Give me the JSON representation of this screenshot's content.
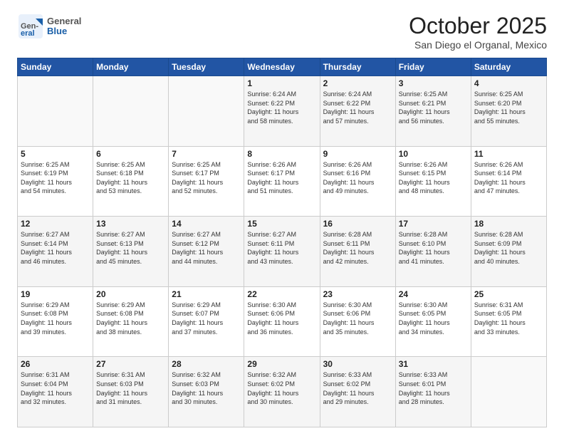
{
  "logo": {
    "general": "General",
    "blue": "Blue"
  },
  "header": {
    "month": "October 2025",
    "location": "San Diego el Organal, Mexico"
  },
  "days_of_week": [
    "Sunday",
    "Monday",
    "Tuesday",
    "Wednesday",
    "Thursday",
    "Friday",
    "Saturday"
  ],
  "weeks": [
    [
      {
        "num": "",
        "info": ""
      },
      {
        "num": "",
        "info": ""
      },
      {
        "num": "",
        "info": ""
      },
      {
        "num": "1",
        "info": "Sunrise: 6:24 AM\nSunset: 6:22 PM\nDaylight: 11 hours\nand 58 minutes."
      },
      {
        "num": "2",
        "info": "Sunrise: 6:24 AM\nSunset: 6:22 PM\nDaylight: 11 hours\nand 57 minutes."
      },
      {
        "num": "3",
        "info": "Sunrise: 6:25 AM\nSunset: 6:21 PM\nDaylight: 11 hours\nand 56 minutes."
      },
      {
        "num": "4",
        "info": "Sunrise: 6:25 AM\nSunset: 6:20 PM\nDaylight: 11 hours\nand 55 minutes."
      }
    ],
    [
      {
        "num": "5",
        "info": "Sunrise: 6:25 AM\nSunset: 6:19 PM\nDaylight: 11 hours\nand 54 minutes."
      },
      {
        "num": "6",
        "info": "Sunrise: 6:25 AM\nSunset: 6:18 PM\nDaylight: 11 hours\nand 53 minutes."
      },
      {
        "num": "7",
        "info": "Sunrise: 6:25 AM\nSunset: 6:17 PM\nDaylight: 11 hours\nand 52 minutes."
      },
      {
        "num": "8",
        "info": "Sunrise: 6:26 AM\nSunset: 6:17 PM\nDaylight: 11 hours\nand 51 minutes."
      },
      {
        "num": "9",
        "info": "Sunrise: 6:26 AM\nSunset: 6:16 PM\nDaylight: 11 hours\nand 49 minutes."
      },
      {
        "num": "10",
        "info": "Sunrise: 6:26 AM\nSunset: 6:15 PM\nDaylight: 11 hours\nand 48 minutes."
      },
      {
        "num": "11",
        "info": "Sunrise: 6:26 AM\nSunset: 6:14 PM\nDaylight: 11 hours\nand 47 minutes."
      }
    ],
    [
      {
        "num": "12",
        "info": "Sunrise: 6:27 AM\nSunset: 6:14 PM\nDaylight: 11 hours\nand 46 minutes."
      },
      {
        "num": "13",
        "info": "Sunrise: 6:27 AM\nSunset: 6:13 PM\nDaylight: 11 hours\nand 45 minutes."
      },
      {
        "num": "14",
        "info": "Sunrise: 6:27 AM\nSunset: 6:12 PM\nDaylight: 11 hours\nand 44 minutes."
      },
      {
        "num": "15",
        "info": "Sunrise: 6:27 AM\nSunset: 6:11 PM\nDaylight: 11 hours\nand 43 minutes."
      },
      {
        "num": "16",
        "info": "Sunrise: 6:28 AM\nSunset: 6:11 PM\nDaylight: 11 hours\nand 42 minutes."
      },
      {
        "num": "17",
        "info": "Sunrise: 6:28 AM\nSunset: 6:10 PM\nDaylight: 11 hours\nand 41 minutes."
      },
      {
        "num": "18",
        "info": "Sunrise: 6:28 AM\nSunset: 6:09 PM\nDaylight: 11 hours\nand 40 minutes."
      }
    ],
    [
      {
        "num": "19",
        "info": "Sunrise: 6:29 AM\nSunset: 6:08 PM\nDaylight: 11 hours\nand 39 minutes."
      },
      {
        "num": "20",
        "info": "Sunrise: 6:29 AM\nSunset: 6:08 PM\nDaylight: 11 hours\nand 38 minutes."
      },
      {
        "num": "21",
        "info": "Sunrise: 6:29 AM\nSunset: 6:07 PM\nDaylight: 11 hours\nand 37 minutes."
      },
      {
        "num": "22",
        "info": "Sunrise: 6:30 AM\nSunset: 6:06 PM\nDaylight: 11 hours\nand 36 minutes."
      },
      {
        "num": "23",
        "info": "Sunrise: 6:30 AM\nSunset: 6:06 PM\nDaylight: 11 hours\nand 35 minutes."
      },
      {
        "num": "24",
        "info": "Sunrise: 6:30 AM\nSunset: 6:05 PM\nDaylight: 11 hours\nand 34 minutes."
      },
      {
        "num": "25",
        "info": "Sunrise: 6:31 AM\nSunset: 6:05 PM\nDaylight: 11 hours\nand 33 minutes."
      }
    ],
    [
      {
        "num": "26",
        "info": "Sunrise: 6:31 AM\nSunset: 6:04 PM\nDaylight: 11 hours\nand 32 minutes."
      },
      {
        "num": "27",
        "info": "Sunrise: 6:31 AM\nSunset: 6:03 PM\nDaylight: 11 hours\nand 31 minutes."
      },
      {
        "num": "28",
        "info": "Sunrise: 6:32 AM\nSunset: 6:03 PM\nDaylight: 11 hours\nand 30 minutes."
      },
      {
        "num": "29",
        "info": "Sunrise: 6:32 AM\nSunset: 6:02 PM\nDaylight: 11 hours\nand 30 minutes."
      },
      {
        "num": "30",
        "info": "Sunrise: 6:33 AM\nSunset: 6:02 PM\nDaylight: 11 hours\nand 29 minutes."
      },
      {
        "num": "31",
        "info": "Sunrise: 6:33 AM\nSunset: 6:01 PM\nDaylight: 11 hours\nand 28 minutes."
      },
      {
        "num": "",
        "info": ""
      }
    ]
  ]
}
